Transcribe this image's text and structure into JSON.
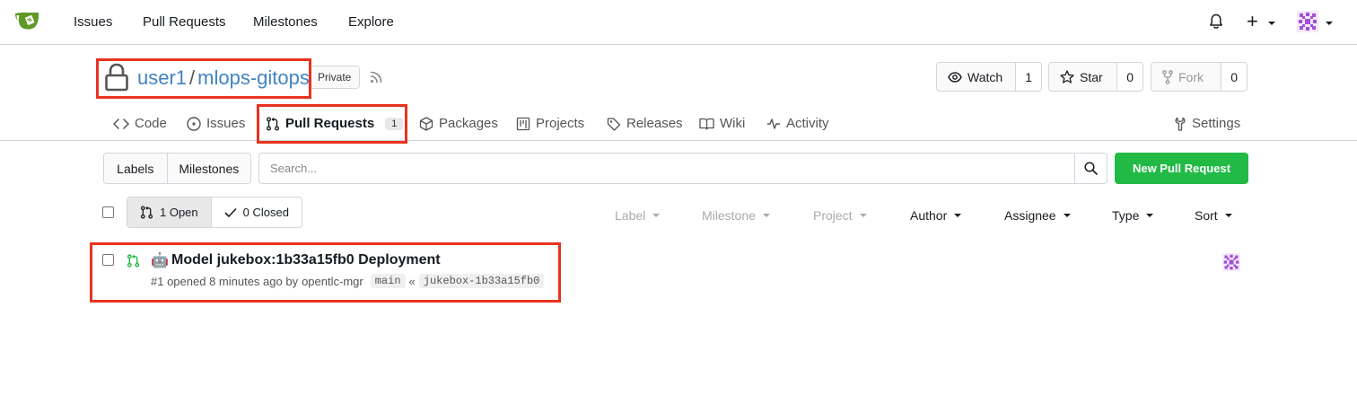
{
  "topnav": {
    "links": [
      "Issues",
      "Pull Requests",
      "Milestones",
      "Explore"
    ],
    "icons": [
      "gitea-logo-icon",
      "bell-icon",
      "plus-icon",
      "avatar"
    ]
  },
  "repo": {
    "owner": "user1",
    "separator": "/",
    "name": "mlops-gitops",
    "visibility": "Private",
    "watch_label": "Watch",
    "watch_count": "1",
    "star_label": "Star",
    "star_count": "0",
    "fork_label": "Fork",
    "fork_count": "0"
  },
  "tabs": {
    "code": "Code",
    "issues": "Issues",
    "pull_requests": "Pull Requests",
    "pull_requests_count": "1",
    "packages": "Packages",
    "projects": "Projects",
    "releases": "Releases",
    "wiki": "Wiki",
    "activity": "Activity",
    "settings": "Settings"
  },
  "filterbar": {
    "labels": "Labels",
    "milestones": "Milestones",
    "search_placeholder": "Search...",
    "new_pr": "New Pull Request"
  },
  "state": {
    "open": "1 Open",
    "closed": "0 Closed"
  },
  "filters": {
    "label": "Label",
    "milestone": "Milestone",
    "project": "Project",
    "author": "Author",
    "assignee": "Assignee",
    "type": "Type",
    "sort": "Sort"
  },
  "issues": [
    {
      "emoji": "🤖",
      "title": "Model jukebox:1b33a15fb0 Deployment",
      "meta_prefix": "#1 opened 8 minutes ago by",
      "author": "opentlc-mgr",
      "target_branch": "main",
      "merge_arrow": "«",
      "source_branch": "jukebox-1b33a15fb0"
    }
  ],
  "colors": {
    "accent_link": "#4183c4",
    "primary_button": "#21ba45",
    "highlight": "#e8331f",
    "avatar": "#a34fd8"
  }
}
